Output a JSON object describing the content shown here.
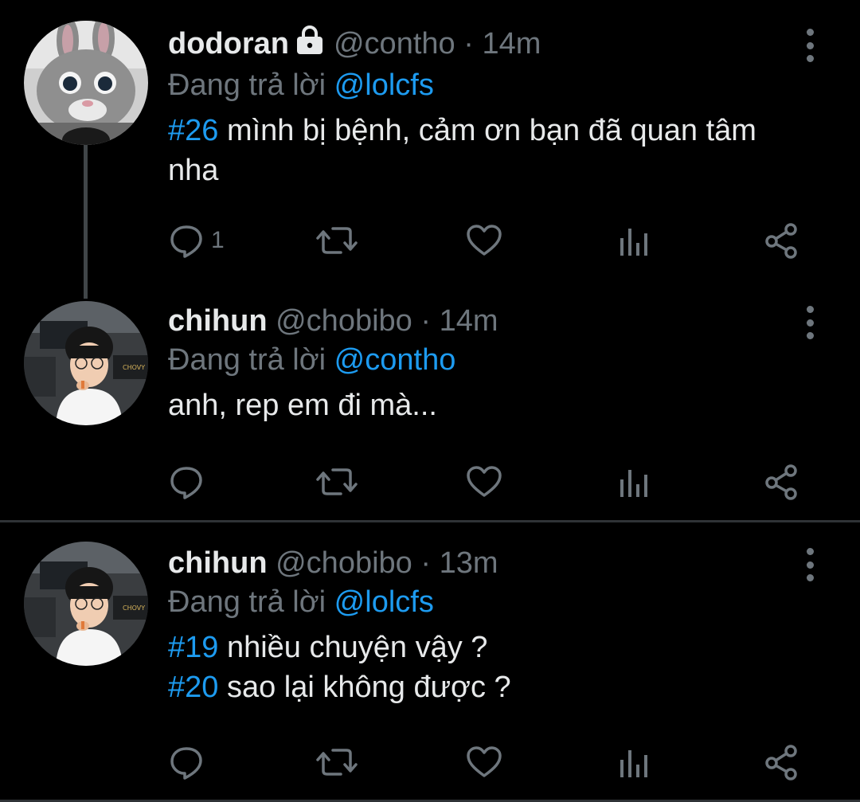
{
  "colors": {
    "background": "#000000",
    "accent": "#1d9bf0",
    "text_primary": "#e7e9ea",
    "text_secondary": "#6e767d",
    "divider": "#2f3336"
  },
  "tweets": [
    {
      "display_name": "dodoran",
      "protected": true,
      "handle": "@contho",
      "separator": "·",
      "time": "14m",
      "reply_prefix": "Đang trả lời",
      "reply_to": "@lolcfs",
      "body": [
        {
          "hashtag": "#26",
          "text": " mình bị bệnh, cảm ơn bạn đã quan tâm nha"
        }
      ],
      "reply_count": "1",
      "avatar": "rabbit-mascot-avatar"
    },
    {
      "display_name": "chihun",
      "protected": false,
      "handle": "@chobibo",
      "separator": "·",
      "time": "14m",
      "reply_prefix": "Đang trả lời",
      "reply_to": "@contho",
      "body": [
        {
          "hashtag": "",
          "text": "anh, rep em đi mà..."
        }
      ],
      "reply_count": "",
      "avatar": "person-photo-avatar"
    },
    {
      "display_name": "chihun",
      "protected": false,
      "handle": "@chobibo",
      "separator": "·",
      "time": "13m",
      "reply_prefix": "Đang trả lời",
      "reply_to": "@lolcfs",
      "body": [
        {
          "hashtag": "#19",
          "text": " nhiều chuyện vậy ?"
        },
        {
          "hashtag": "#20",
          "text": " sao lại không được ?"
        }
      ],
      "reply_count": "",
      "avatar": "person-photo-avatar"
    }
  ],
  "icons": {
    "reply": "reply-icon",
    "retweet": "retweet-icon",
    "like": "heart-icon",
    "analytics": "analytics-icon",
    "share": "share-icon",
    "more": "more-options-icon",
    "lock": "lock-icon"
  }
}
